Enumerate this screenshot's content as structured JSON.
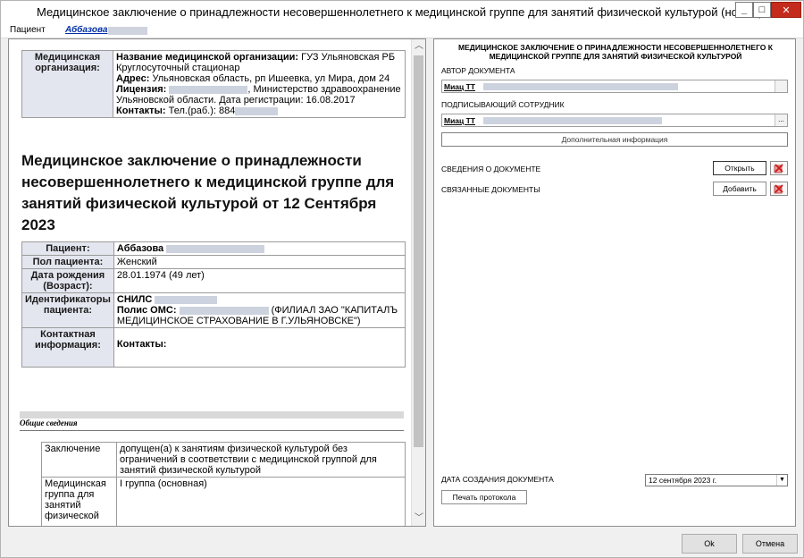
{
  "window": {
    "title": "Медицинское заключение о принадлежности несовершеннолетнего к медицинской группе для занятий физической культурой (новый)",
    "minimize": "_",
    "maximize": "□",
    "close": "✕"
  },
  "tabs": {
    "patient_label": "Пациент",
    "patient_name": "Аббазова"
  },
  "document": {
    "org": {
      "label": "Медицинская организация:",
      "name_key": "Название медицинской организации:",
      "name_val": "ГУЗ Ульяновская РБ Круглосуточный стационар",
      "address_key": "Адрес:",
      "address_val": "Ульяновская область, рп Ишеевка, ул Мира, дом 24",
      "license_key": "Лицензия:",
      "license_val": ", Министерство здравоохранение Ульяновской области. Дата регистрации: 16.08.2017",
      "contacts_key": "Контакты:",
      "contacts_val": "Тел.(раб.): 884"
    },
    "title": "Медицинское заключение о принадлежности несовершеннолетнего к медицинской группе для занятий физической культурой от 12 Сентября 2023",
    "patient": {
      "patient_label": "Пациент:",
      "patient_val": "Аббазова",
      "sex_label": "Пол пациента:",
      "sex_val": "Женский",
      "dob_label": "Дата рождения (Возраст):",
      "dob_val": "28.01.1974 (49 лет)",
      "ids_label": "Идентификаторы пациента:",
      "snils_key": "СНИЛС",
      "oms_key": "Полис ОМС:",
      "oms_val": "(ФИЛИАЛ ЗАО \"КАПИТАЛЪ МЕДИЦИНСКОЕ СТРАХОВАНИЕ В Г.УЛЬЯНОВСКЕ\")",
      "contact_label": "Контактная информация:",
      "contact_val": "Контакты:"
    },
    "general": {
      "section_title": "Общие сведения",
      "conclusion_label": "Заключение",
      "conclusion_val": "допущен(а) к занятиям физической культурой без ограничений в соответствии с медицинской группой для занятий физической культурой",
      "group_label": "Медицинская группа для занятий физической",
      "group_val": "I группа (основная)"
    }
  },
  "panel": {
    "heading": "МЕДИЦИНСКОЕ ЗАКЛЮЧЕНИЕ О ПРИНАДЛЕЖНОСТИ НЕСОВЕРШЕННОЛЕТНЕГО К МЕДИЦИНСКОЙ ГРУППЕ ДЛЯ ЗАНЯТИЙ ФИЗИЧЕСКОЙ КУЛЬТУРОЙ",
    "author_label": "АВТОР ДОКУМЕНТА",
    "author_val": "Миац ТТ",
    "signer_label": "ПОДПИСЫВАЮЩИЙ СОТРУДНИК",
    "signer_val": "Миац ТТ",
    "dots": "...",
    "extra_info": "Дополнительная информация",
    "doc_info_label": "СВЕДЕНИЯ О ДОКУМЕНТЕ",
    "open_btn": "Открыть",
    "related_label": "СВЯЗАННЫЕ ДОКУМЕНТЫ",
    "add_btn": "Добавить",
    "created_label": "ДАТА СОЗДАНИЯ ДОКУМЕНТА",
    "created_val": "12 сентября 2023 г.",
    "print_btn": "Печать протокола"
  },
  "footer": {
    "ok": "Ok",
    "cancel": "Отмена"
  },
  "colors": {
    "close_button": "#c42b1c",
    "label_cell": "#e4e6ef",
    "link": "#002fa7"
  }
}
